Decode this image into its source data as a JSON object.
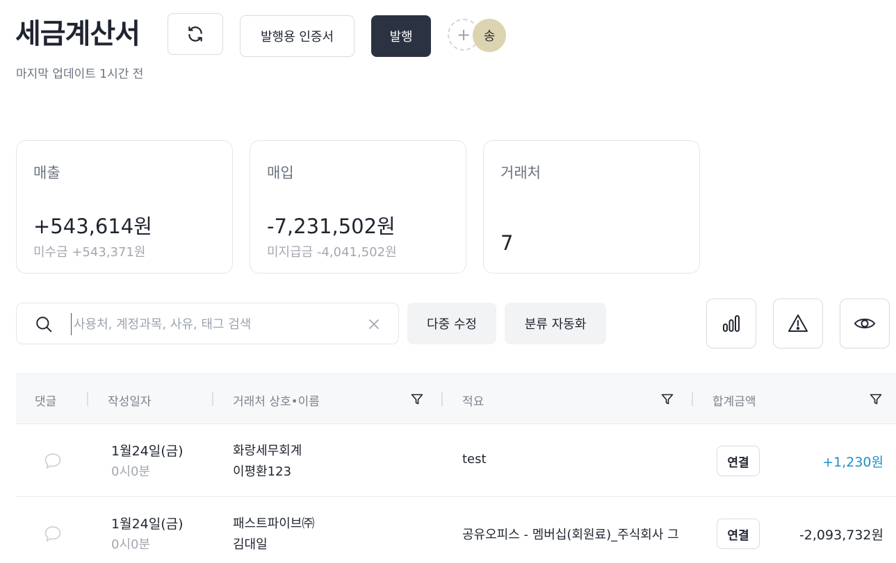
{
  "header": {
    "title": "세금계산서",
    "subtitle": "마지막 업데이트 1시간 전",
    "cert_button": "발행용 인증서",
    "issue_button": "발행",
    "add_member_symbol": "+",
    "avatar_initial": "송"
  },
  "summary": {
    "sales": {
      "label": "매출",
      "amount": "+543,614원",
      "sub": "미수금 +543,371원"
    },
    "purchase": {
      "label": "매입",
      "amount": "-7,231,502원",
      "sub": "미지급금 -4,041,502원"
    },
    "partners": {
      "label": "거래처",
      "count": "7"
    }
  },
  "search": {
    "placeholder": "사용처, 계정과목, 사유, 태그 검색",
    "value": ""
  },
  "actions": {
    "multi_edit": "다중 수정",
    "auto_classify": "분류 자동화"
  },
  "table": {
    "columns": {
      "comment": "댓글",
      "date": "작성일자",
      "partner": "거래처 상호•이름",
      "memo": "적요",
      "total": "합계금액"
    },
    "rows": [
      {
        "date": "1월24일(금)",
        "time": "0시0분",
        "partner_name": "화랑세무회계",
        "partner_person": "이평환123",
        "memo": "test",
        "link_label": "연결",
        "amount": "+1,230원"
      },
      {
        "date": "1월24일(금)",
        "time": "0시0분",
        "partner_name": "패스트파이브㈜",
        "partner_person": "김대일",
        "memo": "공유오피스 - 멤버십(회원료)_주식회사 그",
        "link_label": "연결",
        "amount": "-2,093,732원"
      }
    ]
  },
  "colors": {
    "dark_button": "#2b3241",
    "positive_amount": "#1a8fc9",
    "avatar_bg": "#dcd3b0"
  }
}
